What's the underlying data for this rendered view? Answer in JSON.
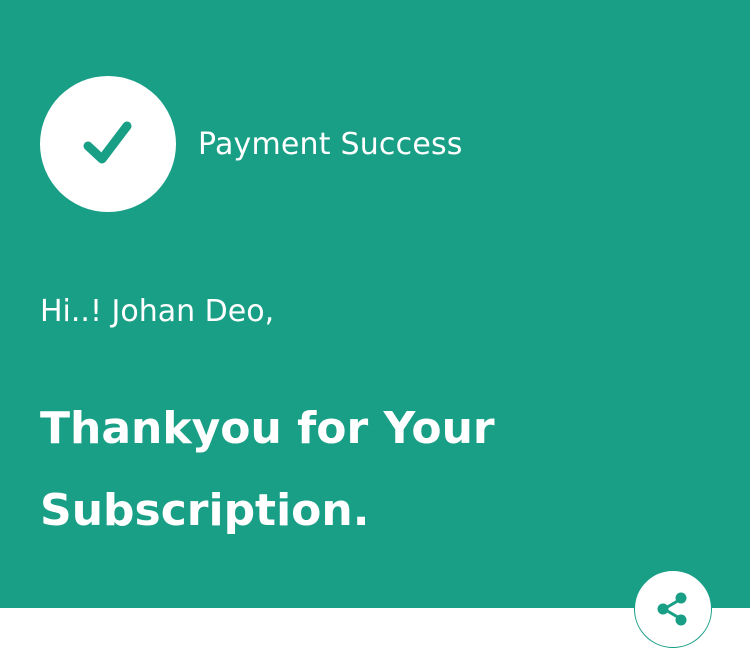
{
  "colors": {
    "accent": "#189f86",
    "background": "#ffffff",
    "text_on_accent": "#ffffff"
  },
  "status": {
    "icon": "checkmark-icon",
    "title": "Payment Success"
  },
  "message": {
    "greeting": "Hi..! Johan Deo,",
    "headline": "Thankyou for Your Subscription."
  },
  "actions": {
    "share_icon": "share-icon"
  }
}
